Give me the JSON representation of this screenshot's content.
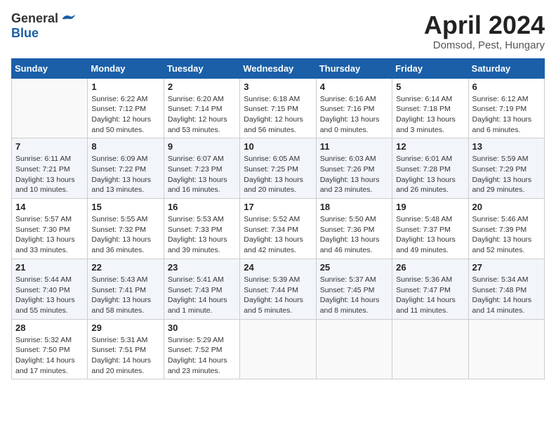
{
  "header": {
    "logo_general": "General",
    "logo_blue": "Blue",
    "title": "April 2024",
    "location": "Domsod, Pest, Hungary"
  },
  "days_of_week": [
    "Sunday",
    "Monday",
    "Tuesday",
    "Wednesday",
    "Thursday",
    "Friday",
    "Saturday"
  ],
  "weeks": [
    [
      {
        "day": "",
        "info": ""
      },
      {
        "day": "1",
        "info": "Sunrise: 6:22 AM\nSunset: 7:12 PM\nDaylight: 12 hours\nand 50 minutes."
      },
      {
        "day": "2",
        "info": "Sunrise: 6:20 AM\nSunset: 7:14 PM\nDaylight: 12 hours\nand 53 minutes."
      },
      {
        "day": "3",
        "info": "Sunrise: 6:18 AM\nSunset: 7:15 PM\nDaylight: 12 hours\nand 56 minutes."
      },
      {
        "day": "4",
        "info": "Sunrise: 6:16 AM\nSunset: 7:16 PM\nDaylight: 13 hours\nand 0 minutes."
      },
      {
        "day": "5",
        "info": "Sunrise: 6:14 AM\nSunset: 7:18 PM\nDaylight: 13 hours\nand 3 minutes."
      },
      {
        "day": "6",
        "info": "Sunrise: 6:12 AM\nSunset: 7:19 PM\nDaylight: 13 hours\nand 6 minutes."
      }
    ],
    [
      {
        "day": "7",
        "info": "Sunrise: 6:11 AM\nSunset: 7:21 PM\nDaylight: 13 hours\nand 10 minutes."
      },
      {
        "day": "8",
        "info": "Sunrise: 6:09 AM\nSunset: 7:22 PM\nDaylight: 13 hours\nand 13 minutes."
      },
      {
        "day": "9",
        "info": "Sunrise: 6:07 AM\nSunset: 7:23 PM\nDaylight: 13 hours\nand 16 minutes."
      },
      {
        "day": "10",
        "info": "Sunrise: 6:05 AM\nSunset: 7:25 PM\nDaylight: 13 hours\nand 20 minutes."
      },
      {
        "day": "11",
        "info": "Sunrise: 6:03 AM\nSunset: 7:26 PM\nDaylight: 13 hours\nand 23 minutes."
      },
      {
        "day": "12",
        "info": "Sunrise: 6:01 AM\nSunset: 7:28 PM\nDaylight: 13 hours\nand 26 minutes."
      },
      {
        "day": "13",
        "info": "Sunrise: 5:59 AM\nSunset: 7:29 PM\nDaylight: 13 hours\nand 29 minutes."
      }
    ],
    [
      {
        "day": "14",
        "info": "Sunrise: 5:57 AM\nSunset: 7:30 PM\nDaylight: 13 hours\nand 33 minutes."
      },
      {
        "day": "15",
        "info": "Sunrise: 5:55 AM\nSunset: 7:32 PM\nDaylight: 13 hours\nand 36 minutes."
      },
      {
        "day": "16",
        "info": "Sunrise: 5:53 AM\nSunset: 7:33 PM\nDaylight: 13 hours\nand 39 minutes."
      },
      {
        "day": "17",
        "info": "Sunrise: 5:52 AM\nSunset: 7:34 PM\nDaylight: 13 hours\nand 42 minutes."
      },
      {
        "day": "18",
        "info": "Sunrise: 5:50 AM\nSunset: 7:36 PM\nDaylight: 13 hours\nand 46 minutes."
      },
      {
        "day": "19",
        "info": "Sunrise: 5:48 AM\nSunset: 7:37 PM\nDaylight: 13 hours\nand 49 minutes."
      },
      {
        "day": "20",
        "info": "Sunrise: 5:46 AM\nSunset: 7:39 PM\nDaylight: 13 hours\nand 52 minutes."
      }
    ],
    [
      {
        "day": "21",
        "info": "Sunrise: 5:44 AM\nSunset: 7:40 PM\nDaylight: 13 hours\nand 55 minutes."
      },
      {
        "day": "22",
        "info": "Sunrise: 5:43 AM\nSunset: 7:41 PM\nDaylight: 13 hours\nand 58 minutes."
      },
      {
        "day": "23",
        "info": "Sunrise: 5:41 AM\nSunset: 7:43 PM\nDaylight: 14 hours\nand 1 minute."
      },
      {
        "day": "24",
        "info": "Sunrise: 5:39 AM\nSunset: 7:44 PM\nDaylight: 14 hours\nand 5 minutes."
      },
      {
        "day": "25",
        "info": "Sunrise: 5:37 AM\nSunset: 7:45 PM\nDaylight: 14 hours\nand 8 minutes."
      },
      {
        "day": "26",
        "info": "Sunrise: 5:36 AM\nSunset: 7:47 PM\nDaylight: 14 hours\nand 11 minutes."
      },
      {
        "day": "27",
        "info": "Sunrise: 5:34 AM\nSunset: 7:48 PM\nDaylight: 14 hours\nand 14 minutes."
      }
    ],
    [
      {
        "day": "28",
        "info": "Sunrise: 5:32 AM\nSunset: 7:50 PM\nDaylight: 14 hours\nand 17 minutes."
      },
      {
        "day": "29",
        "info": "Sunrise: 5:31 AM\nSunset: 7:51 PM\nDaylight: 14 hours\nand 20 minutes."
      },
      {
        "day": "30",
        "info": "Sunrise: 5:29 AM\nSunset: 7:52 PM\nDaylight: 14 hours\nand 23 minutes."
      },
      {
        "day": "",
        "info": ""
      },
      {
        "day": "",
        "info": ""
      },
      {
        "day": "",
        "info": ""
      },
      {
        "day": "",
        "info": ""
      }
    ]
  ]
}
